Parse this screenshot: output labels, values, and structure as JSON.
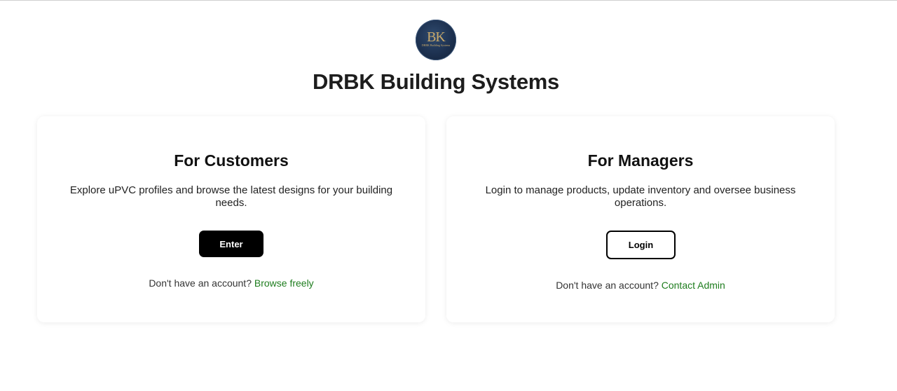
{
  "brand": {
    "logo_mark": "BK",
    "logo_subtext": "DRBK Building Systems",
    "title": "DRBK Building Systems"
  },
  "customers": {
    "title": "For Customers",
    "description": "Explore uPVC profiles and browse the latest designs for your building needs.",
    "button_label": "Enter",
    "footer_prompt": "Don't have an account?",
    "footer_link": "Browse freely"
  },
  "managers": {
    "title": "For Managers",
    "description": "Login to manage products, update inventory and oversee business operations.",
    "button_label": "Login",
    "footer_prompt": "Don't have an account?",
    "footer_link": "Contact Admin"
  },
  "colors": {
    "link": "#1e7d1e",
    "primary_button": "#000000",
    "logo_background": "#1d3150",
    "logo_gold": "#c9a96a"
  }
}
